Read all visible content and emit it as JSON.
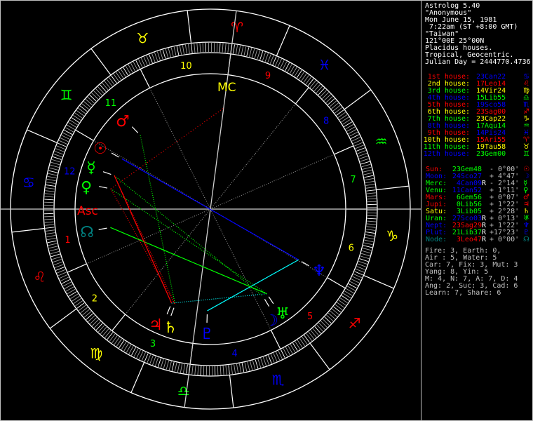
{
  "header": {
    "app_title": "Astrolog 5.40",
    "name": "\"Anonymous\"",
    "date": "Mon June 15, 1981",
    "time": " 7:22am (ST +8:00 GMT)",
    "place": "\"Taiwan\"",
    "coords": "121°00E 25°00N",
    "house_system": "Placidus houses.",
    "zodiac": "Tropical, Geocentric.",
    "julian_day": "Julian Day = 2444770.4736"
  },
  "colors": {
    "red": "#ff0000",
    "yellow": "#ffff00",
    "green": "#00ff00",
    "blue": "#0000ff",
    "cyan": "#008080",
    "white": "#ffffff",
    "gray": "#c0c0c0"
  },
  "houses": [
    {
      "label": "1st house:",
      "cusp": "23Can22",
      "sign_glyph": "♋",
      "label_color": "#ff0000",
      "value_color": "#0000ff",
      "lon": 113.37
    },
    {
      "label": "2nd house:",
      "cusp": "17Leo14",
      "sign_glyph": "♌",
      "label_color": "#ffff00",
      "value_color": "#ff0000",
      "lon": 137.23
    },
    {
      "label": "3rd house:",
      "cusp": "14Vir24",
      "sign_glyph": "♍",
      "label_color": "#00ff00",
      "value_color": "#ffff00",
      "lon": 164.4
    },
    {
      "label": "4th house:",
      "cusp": "15Lib55",
      "sign_glyph": "♎",
      "label_color": "#0000ff",
      "value_color": "#00ff00",
      "lon": 195.92
    },
    {
      "label": "5th house:",
      "cusp": "19Sco58",
      "sign_glyph": "♏",
      "label_color": "#ff0000",
      "value_color": "#0000ff",
      "lon": 229.97
    },
    {
      "label": "6th house:",
      "cusp": "23Sag00",
      "sign_glyph": "♐",
      "label_color": "#ffff00",
      "value_color": "#ff0000",
      "lon": 263.0
    },
    {
      "label": "7th house:",
      "cusp": "23Cap22",
      "sign_glyph": "♑",
      "label_color": "#00ff00",
      "value_color": "#ffff00",
      "lon": 293.37
    },
    {
      "label": "8th house:",
      "cusp": "17Aqu14",
      "sign_glyph": "♒",
      "label_color": "#0000ff",
      "value_color": "#00ff00",
      "lon": 317.23
    },
    {
      "label": "9th house:",
      "cusp": "14Pis24",
      "sign_glyph": "♓",
      "label_color": "#ff0000",
      "value_color": "#0000ff",
      "lon": 344.4
    },
    {
      "label": "10th house:",
      "cusp": "15Ari55",
      "sign_glyph": "♈",
      "label_color": "#ffff00",
      "value_color": "#ff0000",
      "lon": 15.92
    },
    {
      "label": "11th house:",
      "cusp": "19Tau58",
      "sign_glyph": "♉",
      "label_color": "#00ff00",
      "value_color": "#ffff00",
      "lon": 49.97
    },
    {
      "label": "12th house:",
      "cusp": "23Gem00",
      "sign_glyph": "♊",
      "label_color": "#0000ff",
      "value_color": "#00ff00",
      "lon": 83.0
    }
  ],
  "planets": [
    {
      "name": "Sun:",
      "pos": "23Gem48",
      "retro": "",
      "lat": "- 0°00'",
      "glyph": "☉",
      "name_color": "#ff0000",
      "value_color": "#00ff00",
      "lon": 83.8
    },
    {
      "name": "Moon:",
      "pos": "24Sco27",
      "retro": "",
      "lat": "+ 4°47'",
      "glyph": "☽",
      "name_color": "#0000ff",
      "value_color": "#0000ff",
      "lon": 234.45
    },
    {
      "name": "Merc:",
      "pos": "4Can09",
      "retro": "R",
      "lat": "- 2°14'",
      "glyph": "☿",
      "name_color": "#00ff00",
      "value_color": "#0000ff",
      "lon": 94.15
    },
    {
      "name": "Venu:",
      "pos": "11Can52",
      "retro": "",
      "lat": "+ 1°11'",
      "glyph": "♀",
      "name_color": "#00ff00",
      "value_color": "#0000ff",
      "lon": 101.87
    },
    {
      "name": "Mars:",
      "pos": "6Gem56",
      "retro": "",
      "lat": "+ 0°07'",
      "glyph": "♂",
      "name_color": "#ff0000",
      "value_color": "#00ff00",
      "lon": 66.93
    },
    {
      "name": "Jupi:",
      "pos": "0Lib56",
      "retro": "",
      "lat": "+ 1°22'",
      "glyph": "♃",
      "name_color": "#ff0000",
      "value_color": "#00ff00",
      "lon": 180.93
    },
    {
      "name": "Satu:",
      "pos": "3Lib05",
      "retro": "",
      "lat": "+ 2°28'",
      "glyph": "♄",
      "name_color": "#ffff00",
      "value_color": "#00ff00",
      "lon": 183.08
    },
    {
      "name": "Uran:",
      "pos": "27Sco03",
      "retro": "R",
      "lat": "+ 0°13'",
      "glyph": "♅",
      "name_color": "#00ff00",
      "value_color": "#0000ff",
      "lon": 237.05
    },
    {
      "name": "Nept:",
      "pos": "23Sag29",
      "retro": "R",
      "lat": "+ 1°22'",
      "glyph": "♆",
      "name_color": "#0000ff",
      "value_color": "#ff0000",
      "lon": 263.48
    },
    {
      "name": "Plut:",
      "pos": "21Lib37",
      "retro": "R",
      "lat": "+17°23'",
      "glyph": "♇",
      "name_color": "#0000ff",
      "value_color": "#00ff00",
      "lon": 201.62
    },
    {
      "name": "Node:",
      "pos": "3Leo47",
      "retro": "R",
      "lat": "+ 0°00'",
      "glyph": "☊",
      "name_color": "#008080",
      "value_color": "#ff0000",
      "lon": 123.78
    }
  ],
  "stats": [
    "Fire: 3, Earth: 0,",
    "Air : 5, Water: 5",
    "Car: 7, Fix: 3, Mut: 3",
    "Yang: 8, Yin: 5",
    "M: 4, N: 7, A: 7, D: 4",
    "Ang: 2, Suc: 3, Cad: 6",
    "Learn: 7, Share: 6"
  ],
  "wheel": {
    "asc_label": "Asc",
    "mc_label": "MC",
    "house_numbers": [
      "1",
      "2",
      "3",
      "4",
      "5",
      "6",
      "7",
      "8",
      "9",
      "10",
      "11",
      "12"
    ],
    "sign_glyphs": [
      "♈",
      "♉",
      "♊",
      "♋",
      "♌",
      "♍",
      "♎",
      "♏",
      "♐",
      "♑",
      "♒",
      "♓"
    ]
  }
}
